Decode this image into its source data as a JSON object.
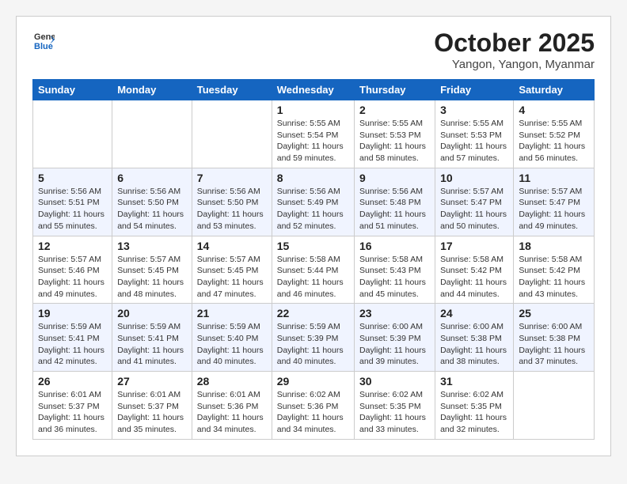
{
  "header": {
    "logo_line1": "General",
    "logo_line2": "Blue",
    "month_title": "October 2025",
    "location": "Yangon, Yangon, Myanmar"
  },
  "weekdays": [
    "Sunday",
    "Monday",
    "Tuesday",
    "Wednesday",
    "Thursday",
    "Friday",
    "Saturday"
  ],
  "weeks": [
    [
      {
        "day": "",
        "info": ""
      },
      {
        "day": "",
        "info": ""
      },
      {
        "day": "",
        "info": ""
      },
      {
        "day": "1",
        "info": "Sunrise: 5:55 AM\nSunset: 5:54 PM\nDaylight: 11 hours\nand 59 minutes."
      },
      {
        "day": "2",
        "info": "Sunrise: 5:55 AM\nSunset: 5:53 PM\nDaylight: 11 hours\nand 58 minutes."
      },
      {
        "day": "3",
        "info": "Sunrise: 5:55 AM\nSunset: 5:53 PM\nDaylight: 11 hours\nand 57 minutes."
      },
      {
        "day": "4",
        "info": "Sunrise: 5:55 AM\nSunset: 5:52 PM\nDaylight: 11 hours\nand 56 minutes."
      }
    ],
    [
      {
        "day": "5",
        "info": "Sunrise: 5:56 AM\nSunset: 5:51 PM\nDaylight: 11 hours\nand 55 minutes."
      },
      {
        "day": "6",
        "info": "Sunrise: 5:56 AM\nSunset: 5:50 PM\nDaylight: 11 hours\nand 54 minutes."
      },
      {
        "day": "7",
        "info": "Sunrise: 5:56 AM\nSunset: 5:50 PM\nDaylight: 11 hours\nand 53 minutes."
      },
      {
        "day": "8",
        "info": "Sunrise: 5:56 AM\nSunset: 5:49 PM\nDaylight: 11 hours\nand 52 minutes."
      },
      {
        "day": "9",
        "info": "Sunrise: 5:56 AM\nSunset: 5:48 PM\nDaylight: 11 hours\nand 51 minutes."
      },
      {
        "day": "10",
        "info": "Sunrise: 5:57 AM\nSunset: 5:47 PM\nDaylight: 11 hours\nand 50 minutes."
      },
      {
        "day": "11",
        "info": "Sunrise: 5:57 AM\nSunset: 5:47 PM\nDaylight: 11 hours\nand 49 minutes."
      }
    ],
    [
      {
        "day": "12",
        "info": "Sunrise: 5:57 AM\nSunset: 5:46 PM\nDaylight: 11 hours\nand 49 minutes."
      },
      {
        "day": "13",
        "info": "Sunrise: 5:57 AM\nSunset: 5:45 PM\nDaylight: 11 hours\nand 48 minutes."
      },
      {
        "day": "14",
        "info": "Sunrise: 5:57 AM\nSunset: 5:45 PM\nDaylight: 11 hours\nand 47 minutes."
      },
      {
        "day": "15",
        "info": "Sunrise: 5:58 AM\nSunset: 5:44 PM\nDaylight: 11 hours\nand 46 minutes."
      },
      {
        "day": "16",
        "info": "Sunrise: 5:58 AM\nSunset: 5:43 PM\nDaylight: 11 hours\nand 45 minutes."
      },
      {
        "day": "17",
        "info": "Sunrise: 5:58 AM\nSunset: 5:42 PM\nDaylight: 11 hours\nand 44 minutes."
      },
      {
        "day": "18",
        "info": "Sunrise: 5:58 AM\nSunset: 5:42 PM\nDaylight: 11 hours\nand 43 minutes."
      }
    ],
    [
      {
        "day": "19",
        "info": "Sunrise: 5:59 AM\nSunset: 5:41 PM\nDaylight: 11 hours\nand 42 minutes."
      },
      {
        "day": "20",
        "info": "Sunrise: 5:59 AM\nSunset: 5:41 PM\nDaylight: 11 hours\nand 41 minutes."
      },
      {
        "day": "21",
        "info": "Sunrise: 5:59 AM\nSunset: 5:40 PM\nDaylight: 11 hours\nand 40 minutes."
      },
      {
        "day": "22",
        "info": "Sunrise: 5:59 AM\nSunset: 5:39 PM\nDaylight: 11 hours\nand 40 minutes."
      },
      {
        "day": "23",
        "info": "Sunrise: 6:00 AM\nSunset: 5:39 PM\nDaylight: 11 hours\nand 39 minutes."
      },
      {
        "day": "24",
        "info": "Sunrise: 6:00 AM\nSunset: 5:38 PM\nDaylight: 11 hours\nand 38 minutes."
      },
      {
        "day": "25",
        "info": "Sunrise: 6:00 AM\nSunset: 5:38 PM\nDaylight: 11 hours\nand 37 minutes."
      }
    ],
    [
      {
        "day": "26",
        "info": "Sunrise: 6:01 AM\nSunset: 5:37 PM\nDaylight: 11 hours\nand 36 minutes."
      },
      {
        "day": "27",
        "info": "Sunrise: 6:01 AM\nSunset: 5:37 PM\nDaylight: 11 hours\nand 35 minutes."
      },
      {
        "day": "28",
        "info": "Sunrise: 6:01 AM\nSunset: 5:36 PM\nDaylight: 11 hours\nand 34 minutes."
      },
      {
        "day": "29",
        "info": "Sunrise: 6:02 AM\nSunset: 5:36 PM\nDaylight: 11 hours\nand 34 minutes."
      },
      {
        "day": "30",
        "info": "Sunrise: 6:02 AM\nSunset: 5:35 PM\nDaylight: 11 hours\nand 33 minutes."
      },
      {
        "day": "31",
        "info": "Sunrise: 6:02 AM\nSunset: 5:35 PM\nDaylight: 11 hours\nand 32 minutes."
      },
      {
        "day": "",
        "info": ""
      }
    ]
  ]
}
